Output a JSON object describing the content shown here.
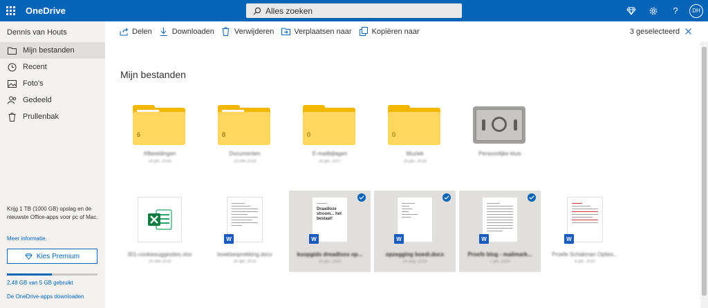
{
  "header": {
    "brand": "OneDrive",
    "search_placeholder": "Alles zoeken",
    "avatar_initials": "DH",
    "help_glyph": "?"
  },
  "sidebar": {
    "username": "Dennis van Houts",
    "items": [
      {
        "label": "Mijn bestanden",
        "icon": "folder-icon",
        "active": true
      },
      {
        "label": "Recent",
        "icon": "clock-icon"
      },
      {
        "label": "Foto's",
        "icon": "image-icon"
      },
      {
        "label": "Gedeeld",
        "icon": "people-icon"
      },
      {
        "label": "Prullenbak",
        "icon": "trash-icon"
      }
    ],
    "promo_text": "Krijg 1 TB (1000 GB) opslag en de nieuwste Office-apps voor pc of Mac.",
    "more_info": "Meer informatie.",
    "premium_button": "Kies Premium",
    "usage_text": "2,48 GB van 5 GB gebruikt",
    "usage_fraction": 0.496,
    "apps_link": "De OneDrive-apps downloaden"
  },
  "commands": {
    "share": "Delen",
    "download": "Downloaden",
    "delete": "Verwijderen",
    "move": "Verplaatsen naar",
    "copy": "Kopiëren naar",
    "selected_count": "3 geselecteerd"
  },
  "main": {
    "title": "Mijn bestanden",
    "folders": [
      {
        "name": "Afbeeldingen",
        "date": "16 jan. 2019",
        "count": "6"
      },
      {
        "name": "Documenten",
        "date": "23 mei 2018",
        "count": "8"
      },
      {
        "name": "E-mailbijlagen",
        "date": "16 jan. 2017",
        "count": "0"
      },
      {
        "name": "Muziek",
        "date": "16 jan. 2018",
        "count": "0"
      }
    ],
    "vault": {
      "name": "Persoonlijke kluis"
    },
    "files": [
      {
        "name": "301-cookiesuggesties.xlsx",
        "date": "14 mei 2019",
        "selected": false,
        "type": "excel"
      },
      {
        "name": "boekbesprekking.docx",
        "date": "26 apr. 2019",
        "selected": false,
        "type": "word"
      },
      {
        "name": "koopgids dreadloos op...",
        "date": "15 jan. 2020",
        "selected": true,
        "type": "word",
        "heading": "Draadloze stroom... het bestaat!"
      },
      {
        "name": "opzegging boedi.docx",
        "date": "14 aug. 2019",
        "selected": true,
        "type": "word"
      },
      {
        "name": "Proefe blog - mailmark...",
        "date": "7 jan. 2020",
        "selected": true,
        "type": "word"
      },
      {
        "name": "Proefe Schakman Opties...",
        "date": "6 jan. 2020",
        "selected": false,
        "type": "word"
      }
    ]
  },
  "colors": {
    "accent": "#0364b8",
    "folder": "#ffd75e",
    "selection": "#e1dfdd"
  }
}
